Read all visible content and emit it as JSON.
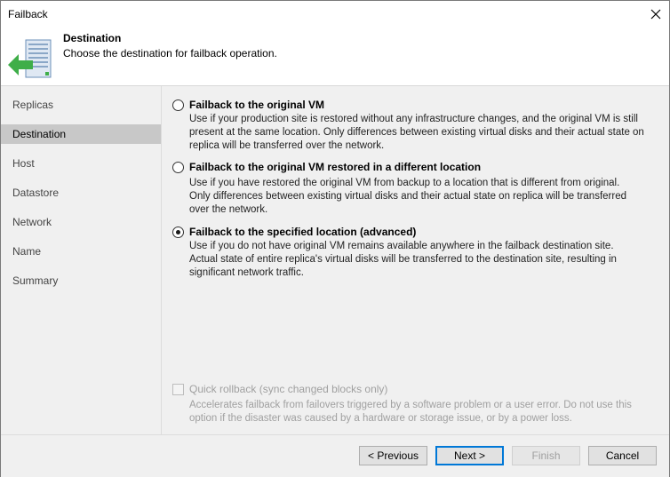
{
  "window": {
    "title": "Failback"
  },
  "header": {
    "title": "Destination",
    "subtitle": "Choose the destination for failback operation."
  },
  "sidebar": {
    "items": [
      {
        "label": "Replicas",
        "active": false
      },
      {
        "label": "Destination",
        "active": true
      },
      {
        "label": "Host",
        "active": false
      },
      {
        "label": "Datastore",
        "active": false
      },
      {
        "label": "Network",
        "active": false
      },
      {
        "label": "Name",
        "active": false
      },
      {
        "label": "Summary",
        "active": false
      }
    ]
  },
  "options": [
    {
      "label": "Failback to the original VM",
      "checked": false,
      "desc": [
        "Use if your production site is restored without any infrastructure changes, and the original VM is still",
        "present at the same location. Only differences between existing virtual disks and their actual state on",
        "replica will be transferred over the network."
      ]
    },
    {
      "label": "Failback to the original VM restored in a different location",
      "checked": false,
      "desc": [
        "Use if you have restored the original VM from backup to a location that is different from original.",
        "Only differences between existing virtual disks and their actual state on replica will be transferred",
        "over the network."
      ]
    },
    {
      "label": "Failback to the specified location (advanced)",
      "checked": true,
      "desc": [
        "Use if you do not have original VM remains available anywhere in the failback destination site.",
        "Actual state of entire replica's virtual disks will be transferred to the destination site, resulting in",
        "significant network traffic."
      ]
    }
  ],
  "quick_rollback": {
    "label": "Quick rollback (sync changed blocks only)",
    "checked": false,
    "enabled": false,
    "desc": [
      "Accelerates failback from failovers triggered by a software problem or a user error. Do not use this",
      "option if the disaster was caused by a hardware or storage issue, or by a power loss."
    ]
  },
  "buttons": {
    "previous": "< Previous",
    "next": "Next >",
    "finish": "Finish",
    "cancel": "Cancel"
  },
  "icons": {
    "close": "close-icon",
    "wizard": "failback-vm-icon"
  },
  "colors": {
    "accent": "#0078d7",
    "icon_green": "#3fae49",
    "active_step": "#c8c8c8"
  }
}
